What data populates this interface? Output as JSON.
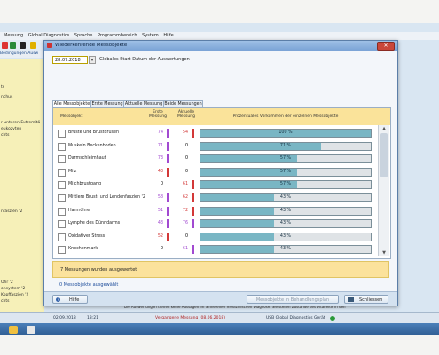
{
  "app": {
    "menu": [
      "Messung",
      "Global Diagnostics",
      "Sprache",
      "Programmbereich",
      "System",
      "Hilfe"
    ],
    "tabs": "Bedingungen   Ausw",
    "sidebar_items": [
      {
        "label": "ts"
      },
      {
        "label": "nchus"
      },
      {
        "label": "r unteren Extremitä"
      },
      {
        "label": "eukozyten"
      },
      {
        "label": "chts"
      },
      {
        "label": "nfaszien '2"
      },
      {
        "label": "Ohr '2"
      },
      {
        "label": "onsystem '2"
      },
      {
        "label": "Kopffaszien '2"
      },
      {
        "label": "chts"
      }
    ],
    "status": {
      "date": "02.09.2018",
      "time": "13:21",
      "measurement": "Vergangene Messung (08.06.2018)",
      "device": "USB Global Diagnostics Gerät"
    },
    "footnote": "Die Auswertungen treffen keine Aussagen im Sinne einer medizinischen Diagnose. Sie stellen Zustände des Vitalfelds in den"
  },
  "dialog": {
    "title": "Wiederkehrende Messobjekte",
    "close_label": "✕",
    "start_date": "28.07.2018",
    "start_date_label": "Globales Start-Datum der Auswertungen",
    "tabs": [
      {
        "label": "Alle Messobjekte",
        "active": true
      },
      {
        "label": "Erste Messung",
        "active": false
      },
      {
        "label": "Aktuelle Messung",
        "active": false
      },
      {
        "label": "Beide Messungen",
        "active": false
      }
    ],
    "columns": {
      "name": "Messobjekt",
      "first": "Erste Messung",
      "current": "Aktuelle Messung",
      "percent": "Prozentuales Vorkommen der einzelnen Messobjekte"
    },
    "rows": [
      {
        "name": "Brüste und Brustdrüsen",
        "first": "74",
        "current": "54",
        "percent": 100,
        "pct_label": "100 %",
        "c1": "#a24ad1",
        "c2": "#d33838"
      },
      {
        "name": "Muskeln Beckenboden",
        "first": "71",
        "current": "0",
        "percent": 71,
        "pct_label": "71 %",
        "c1": "#a24ad1",
        "c2": ""
      },
      {
        "name": "Darmschleimhaut",
        "first": "73",
        "current": "0",
        "percent": 57,
        "pct_label": "57 %",
        "c1": "#a24ad1",
        "c2": ""
      },
      {
        "name": "Milz",
        "first": "43",
        "current": "0",
        "percent": 57,
        "pct_label": "57 %",
        "c1": "#d33838",
        "c2": ""
      },
      {
        "name": "Milchbrustgang",
        "first": "0",
        "current": "61",
        "percent": 57,
        "pct_label": "57 %",
        "c1": "",
        "c2": "#d33838"
      },
      {
        "name": "Mittlere Brust- und Lendenfaszien '2",
        "first": "58",
        "current": "62",
        "percent": 43,
        "pct_label": "43 %",
        "c1": "#a24ad1",
        "c2": "#d33838"
      },
      {
        "name": "Harnröhre",
        "first": "51",
        "current": "72",
        "percent": 43,
        "pct_label": "43 %",
        "c1": "#a24ad1",
        "c2": "#d33838"
      },
      {
        "name": "Lymphe des Dünndarms",
        "first": "43",
        "current": "76",
        "percent": 43,
        "pct_label": "43 %",
        "c1": "#a24ad1",
        "c2": "#a24ad1"
      },
      {
        "name": "Oxidativer Stress",
        "first": "52",
        "current": "0",
        "percent": 43,
        "pct_label": "43 %",
        "c1": "#d33838",
        "c2": ""
      },
      {
        "name": "Knochenmark",
        "first": "0",
        "current": "61",
        "percent": 43,
        "pct_label": "43 %",
        "c1": "",
        "c2": "#a24ad1"
      }
    ],
    "summary": "7 Messungen wurden ausgewertet",
    "selected_count": "0 Messobjekte ausgewählt",
    "footer": {
      "help": "Hilfe",
      "add_to_treatment": "Messobjekte in Behandlungsplan",
      "close": "Schliessen"
    }
  }
}
